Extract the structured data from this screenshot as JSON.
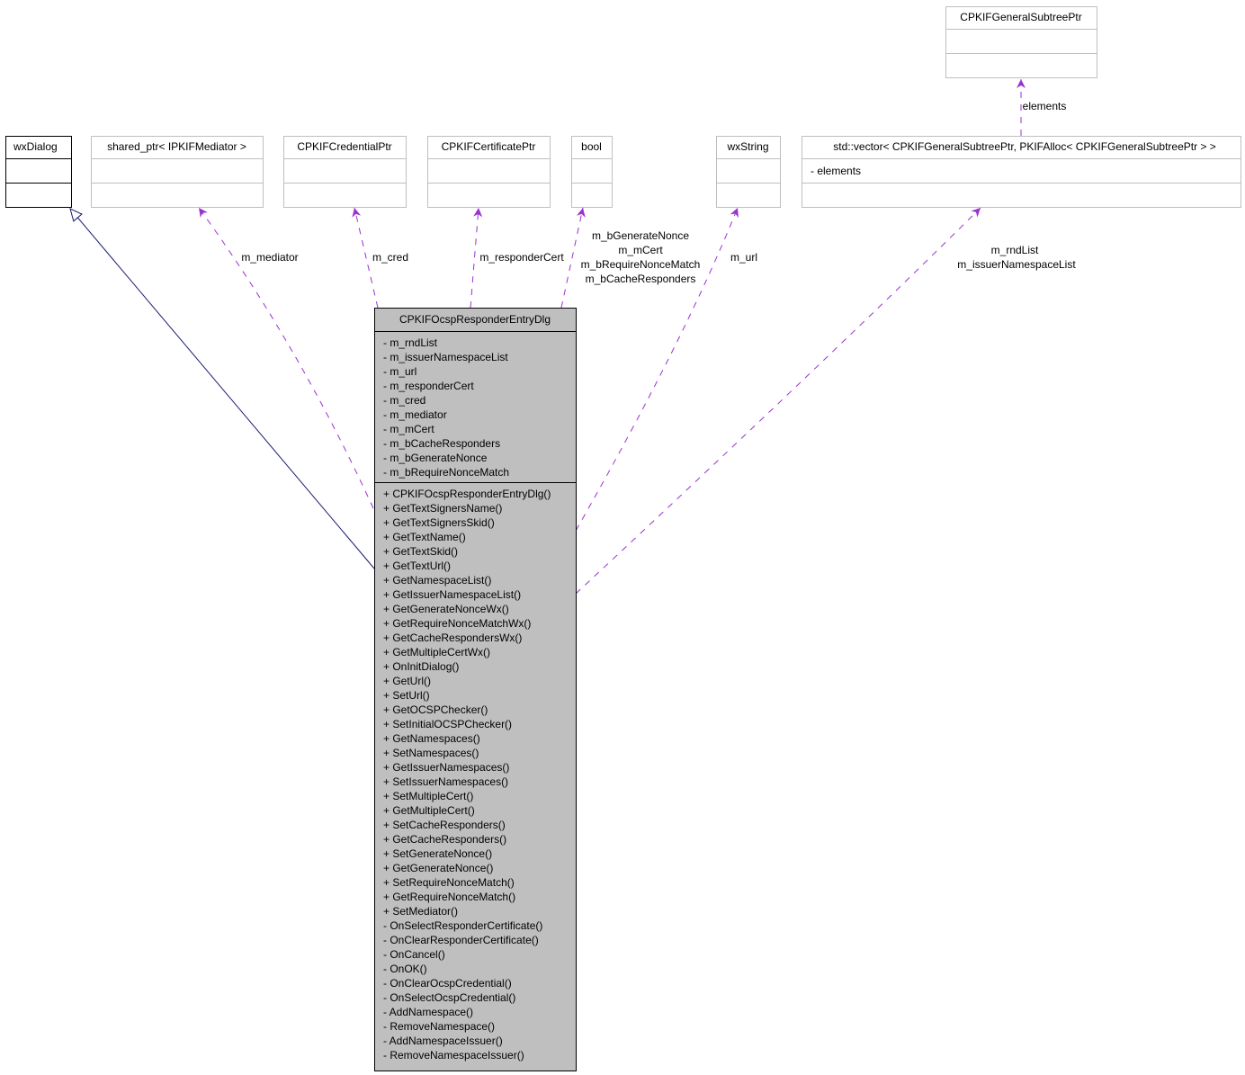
{
  "diagram": {
    "type": "uml-collaboration",
    "main_class": {
      "name": "CPKIFOcspResponderEntryDlg",
      "attributes": [
        "- m_rndList",
        "- m_issuerNamespaceList",
        "- m_url",
        "- m_responderCert",
        "- m_cred",
        "- m_mediator",
        "- m_mCert",
        "- m_bCacheResponders",
        "- m_bGenerateNonce",
        "- m_bRequireNonceMatch"
      ],
      "methods": [
        "+ CPKIFOcspResponderEntryDlg()",
        "+ GetTextSignersName()",
        "+ GetTextSignersSkid()",
        "+ GetTextName()",
        "+ GetTextSkid()",
        "+ GetTextUrl()",
        "+ GetNamespaceList()",
        "+ GetIssuerNamespaceList()",
        "+ GetGenerateNonceWx()",
        "+ GetRequireNonceMatchWx()",
        "+ GetCacheRespondersWx()",
        "+ GetMultipleCertWx()",
        "+ OnInitDialog()",
        "+ GetUrl()",
        "+ SetUrl()",
        "+ GetOCSPChecker()",
        "+ SetInitialOCSPChecker()",
        "+ GetNamespaces()",
        "+ SetNamespaces()",
        "+ GetIssuerNamespaces()",
        "+ SetIssuerNamespaces()",
        "+ SetMultipleCert()",
        "+ GetMultipleCert()",
        "+ SetCacheResponders()",
        "+ GetCacheResponders()",
        "+ SetGenerateNonce()",
        "+ GetGenerateNonce()",
        "+ SetRequireNonceMatch()",
        "+ GetRequireNonceMatch()",
        "+ SetMediator()",
        "- OnSelectResponderCertificate()",
        "- OnClearResponderCertificate()",
        "- OnCancel()",
        "- OnOK()",
        "- OnClearOcspCredential()",
        "- OnSelectOcspCredential()",
        "- AddNamespace()",
        "- RemoveNamespace()",
        "- AddNamespaceIssuer()",
        "- RemoveNamespaceIssuer()"
      ]
    },
    "classes": [
      {
        "id": "wxDialog",
        "name": "wxDialog",
        "attributes": [],
        "style": "solid-black"
      },
      {
        "id": "mediator",
        "name": "shared_ptr< IPKIFMediator >",
        "attributes": [],
        "style": "gray"
      },
      {
        "id": "cred",
        "name": "CPKIFCredentialPtr",
        "attributes": [],
        "style": "gray"
      },
      {
        "id": "cert",
        "name": "CPKIFCertificatePtr",
        "attributes": [],
        "style": "gray"
      },
      {
        "id": "bool",
        "name": "bool",
        "attributes": [],
        "style": "gray"
      },
      {
        "id": "wxString",
        "name": "wxString",
        "attributes": [],
        "style": "gray"
      },
      {
        "id": "vector",
        "name": "std::vector< CPKIFGeneralSubtreePtr, PKIFAlloc< CPKIFGeneralSubtreePtr > >",
        "attributes": [
          "- elements"
        ],
        "style": "gray"
      },
      {
        "id": "subtree",
        "name": "CPKIFGeneralSubtreePtr",
        "attributes": [],
        "style": "gray"
      }
    ],
    "relations": [
      {
        "from": "main",
        "to": "wxDialog",
        "kind": "inheritance",
        "labels": []
      },
      {
        "from": "main",
        "to": "mediator",
        "kind": "usage",
        "labels": [
          "m_mediator"
        ]
      },
      {
        "from": "main",
        "to": "cred",
        "kind": "usage",
        "labels": [
          "m_cred"
        ]
      },
      {
        "from": "main",
        "to": "cert",
        "kind": "usage",
        "labels": [
          "m_responderCert"
        ]
      },
      {
        "from": "main",
        "to": "bool",
        "kind": "usage",
        "labels": [
          "m_bGenerateNonce",
          "m_mCert",
          "m_bRequireNonceMatch",
          "m_bCacheResponders"
        ]
      },
      {
        "from": "main",
        "to": "wxString",
        "kind": "usage",
        "labels": [
          "m_url"
        ]
      },
      {
        "from": "main",
        "to": "vector",
        "kind": "usage",
        "labels": [
          "m_rndList",
          "m_issuerNamespaceList"
        ]
      },
      {
        "from": "vector",
        "to": "subtree",
        "kind": "usage",
        "labels": [
          "elements"
        ]
      }
    ],
    "colors": {
      "inheritance_line": "#191970",
      "usage_line": "#9a32cd",
      "gray_border": "#bfbfbf",
      "main_fill": "#bfbfbf"
    }
  }
}
